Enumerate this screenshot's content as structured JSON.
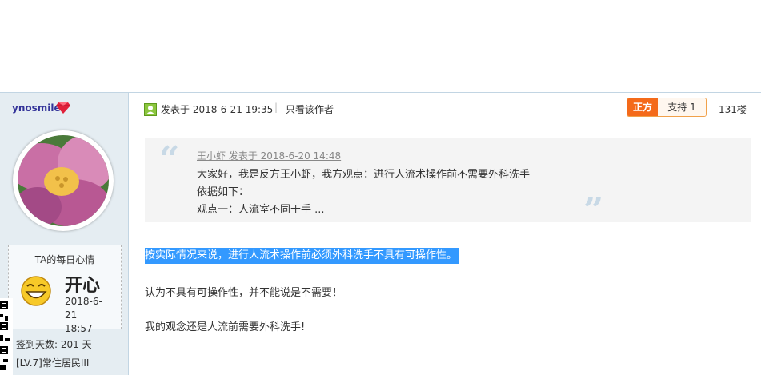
{
  "user": {
    "name": "ynosmile",
    "mood_title": "TA的每日心情",
    "mood": "开心",
    "mood_date": "2018-6-21",
    "mood_time": "18:57",
    "checkin": "签到天数: 201 天",
    "level": "[LV.7]常住居民III"
  },
  "post": {
    "posted": "发表于 2018-6-21 19:35",
    "separator": "|",
    "author_only": "只看该作者",
    "side_label": "正方",
    "support": "支持 1",
    "floor": "131楼"
  },
  "quote": {
    "open_mark": "“",
    "close_mark": "”",
    "author": "王小虾 发表于 2018-6-20 14:48",
    "lines": [
      "大家好，我是反方王小虾，我方观点：进行人流术操作前不需要外科洗手",
      "依据如下：",
      "观点一：人流室不同于手 ..."
    ]
  },
  "body": {
    "highlighted": "按实际情况来说，进行人流术操作前必须外科洗手不具有可操作性。",
    "line2": "认为不具有可操作性，并不能说是不需要！",
    "line3": "我的观念还是人流前需要外科洗手!"
  },
  "colors": {
    "vote_accent": "#f46a1a",
    "selection": "#3399ff",
    "sidebar_bg": "#e5edf2",
    "username": "#333399"
  }
}
